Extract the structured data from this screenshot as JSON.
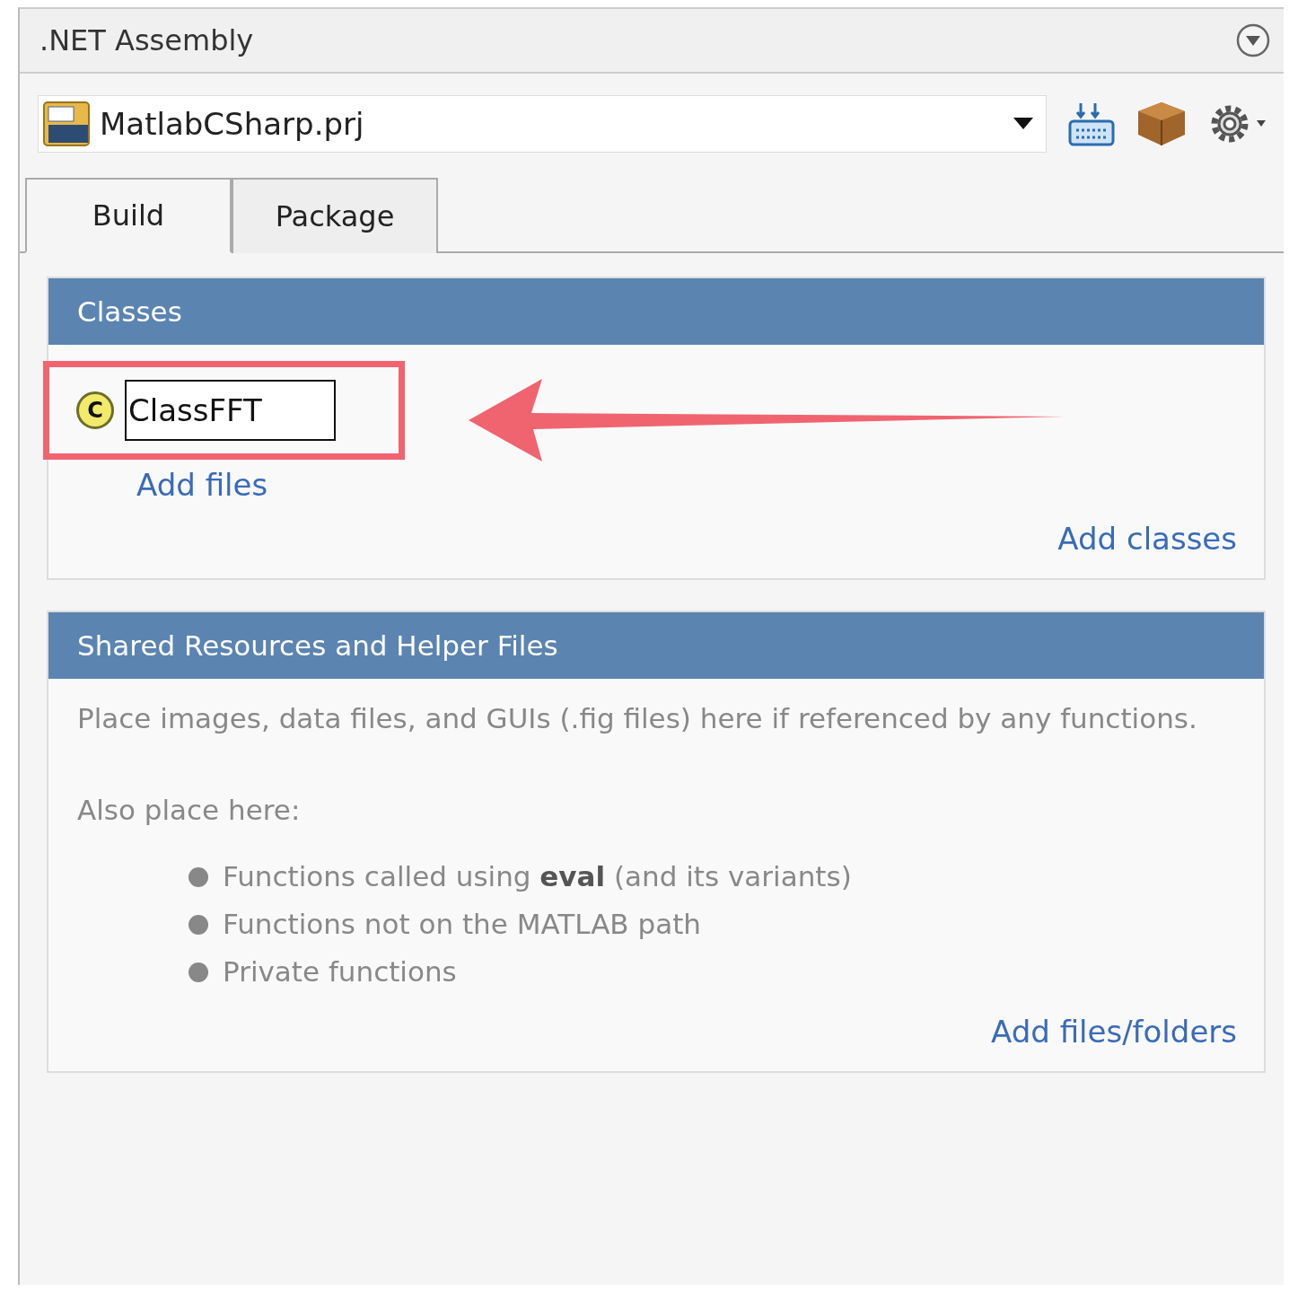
{
  "panel": {
    "title": ".NET Assembly"
  },
  "project": {
    "value": "MatlabCSharp.prj"
  },
  "tabs": [
    {
      "label": "Build",
      "selected": true
    },
    {
      "label": "Package",
      "selected": false
    }
  ],
  "classes": {
    "title": "Classes",
    "items": [
      {
        "icon_letter": "C",
        "name": "ClassFFT",
        "editing": true,
        "highlighted": true
      }
    ],
    "add_files": "Add files",
    "add_classes": "Add classes"
  },
  "shared": {
    "title": "Shared Resources and Helper Files",
    "description": "Place images, data files, and GUIs (.fig files) here if referenced by any functions.",
    "also": "Also place here:",
    "bullets": [
      "Functions called using **eval** (and its variants)",
      "Functions not on the MATLAB path",
      "Private functions"
    ],
    "add": "Add files/folders"
  }
}
